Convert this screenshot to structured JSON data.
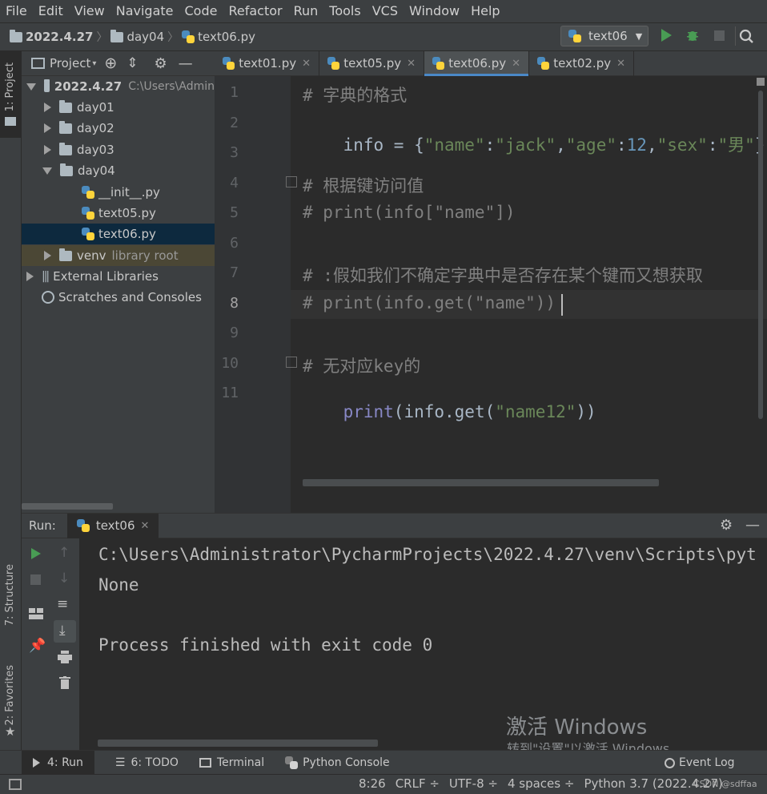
{
  "menu": [
    "File",
    "Edit",
    "View",
    "Navigate",
    "Code",
    "Refactor",
    "Run",
    "Tools",
    "VCS",
    "Window",
    "Help"
  ],
  "breadcrumb": [
    "2022.4.27",
    "day04",
    "text06.py"
  ],
  "run_config": "text06",
  "left_strip": {
    "project": "1: Project",
    "structure": "7: Structure",
    "favorites": "2: Favorites"
  },
  "project_panel": {
    "title": "Project",
    "root": {
      "name": "2022.4.27",
      "path": "C:\\Users\\Admin"
    },
    "items": [
      {
        "label": "day01"
      },
      {
        "label": "day02"
      },
      {
        "label": "day03"
      },
      {
        "label": "day04"
      },
      {
        "label": "__init__.py"
      },
      {
        "label": "text05.py"
      },
      {
        "label": "text06.py"
      },
      {
        "label": "venv",
        "note": "library root"
      },
      {
        "label": "External Libraries"
      },
      {
        "label": "Scratches and Consoles"
      }
    ]
  },
  "tabs": [
    "text01.py",
    "text05.py",
    "text06.py",
    "text02.py"
  ],
  "line_numbers": [
    "1",
    "2",
    "3",
    "4",
    "5",
    "6",
    "7",
    "8",
    "9",
    "10",
    "11"
  ],
  "code": {
    "l1": "# 字典的格式",
    "l2a": "info = {",
    "l2b": "\"name\"",
    "l2c": ":",
    "l2d": "\"jack\"",
    "l2e": ",",
    "l2f": "\"age\"",
    "l2g": ":",
    "l2h": "12",
    "l2i": ",",
    "l2j": "\"sex\"",
    "l2k": ":",
    "l2l": "\"男\"",
    "l2m": "}",
    "l4": "# 根据键访问值",
    "l5": "# print(info[\"name\"])",
    "l7": "# :假如我们不确定字典中是否存在某个键而又想获取",
    "l8": "# print(info.get(\"name\"))",
    "l10": "# 无对应key的",
    "l11a": "print",
    "l11b": "(info.get(",
    "l11c": "\"name12\"",
    "l11d": "))"
  },
  "run_panel": {
    "label": "Run:",
    "tab": "text06",
    "output": [
      "C:\\Users\\Administrator\\PycharmProjects\\2022.4.27\\venv\\Scripts\\pyt",
      "None",
      "",
      "Process finished with exit code 0"
    ]
  },
  "watermark": {
    "title": "激活 Windows",
    "subtitle": "转到\"设置\"以激活 Windows。"
  },
  "bottom_tools": [
    "4: Run",
    "6: TODO",
    "Terminal",
    "Python Console",
    "Event Log"
  ],
  "status": [
    "8:26",
    "CRLF ÷",
    "UTF-8 ÷",
    "4 spaces ÷",
    "Python 3.7 (2022.4.27)"
  ],
  "csdn": "CSDN @sdffaa",
  "colors": {
    "accent": "#4a88c7",
    "run_green": "#499c54",
    "bg_editor": "#2b2b2b",
    "bg_panel": "#3c3f41"
  }
}
